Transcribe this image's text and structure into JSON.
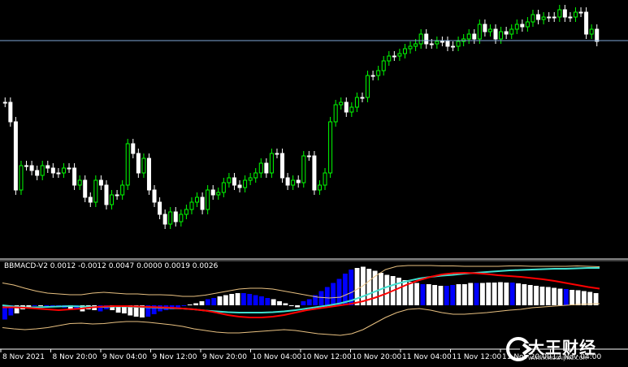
{
  "indicator": {
    "label": "BBMACD-V2 0.0012 -0.0012 0.0047 0.0000 0.0019 0.0026"
  },
  "x_axis": {
    "labels": [
      "8 Nov 2021",
      "8 Nov 20:00",
      "9 Nov 04:00",
      "9 Nov 12:00",
      "9 Nov 20:00",
      "10 Nov 04:00",
      "10 Nov 12:00",
      "10 Nov 20:00",
      "11 Nov 04:00",
      "11 Nov 12:00",
      "11 Nov 20:00",
      "12 Nov 04:00"
    ]
  },
  "watermark": {
    "brand": "大王财经",
    "site": "WWW.KINGCAIJING.COM"
  },
  "colors": {
    "background": "#000000",
    "bull_candle": "#00ff00",
    "bear_candle": "#ffffff",
    "price_line": "#7fa8d6",
    "hist_positive": "#ffffff",
    "hist_negative": "#0000ff",
    "macd_line": "#ff0000",
    "signal_line": "#40e0d0",
    "bands": "#e8c080",
    "separator": "#ffffff"
  },
  "chart_data": {
    "type": "candlestick",
    "title": "",
    "price_pane": {
      "open": [
        0.4,
        0.4,
        0.48,
        0.76,
        0.66,
        0.66,
        0.68,
        0.7,
        0.66,
        0.67,
        0.69,
        0.69,
        0.67,
        0.67,
        0.74,
        0.72,
        0.79,
        0.81,
        0.72,
        0.74,
        0.82,
        0.78,
        0.78,
        0.74,
        0.57,
        0.61,
        0.69,
        0.63,
        0.76,
        0.81,
        0.86,
        0.9,
        0.85,
        0.89,
        0.86,
        0.84,
        0.81,
        0.79,
        0.84,
        0.76,
        0.78,
        0.77,
        0.73,
        0.71,
        0.74,
        0.75,
        0.72,
        0.71,
        0.69,
        0.65,
        0.69,
        0.61,
        0.61,
        0.71,
        0.74,
        0.72,
        0.73,
        0.62,
        0.62,
        0.76,
        0.74,
        0.69,
        0.48,
        0.41,
        0.4,
        0.44,
        0.42,
        0.38,
        0.38,
        0.29,
        0.29,
        0.27,
        0.23,
        0.21,
        0.21,
        0.2,
        0.18,
        0.17,
        0.16,
        0.12,
        0.16,
        0.16,
        0.15,
        0.15,
        0.17,
        0.17,
        0.15,
        0.14,
        0.12,
        0.14,
        0.08,
        0.11,
        0.1,
        0.14,
        0.11,
        0.12,
        0.1,
        0.08,
        0.09,
        0.07,
        0.04,
        0.06,
        0.05,
        0.05,
        0.05,
        0.02,
        0.05,
        0.05,
        0.03,
        0.03,
        0.12,
        0.1
      ],
      "close": [
        0.4,
        0.48,
        0.76,
        0.66,
        0.66,
        0.68,
        0.7,
        0.66,
        0.67,
        0.69,
        0.69,
        0.67,
        0.67,
        0.74,
        0.72,
        0.79,
        0.81,
        0.72,
        0.74,
        0.82,
        0.78,
        0.78,
        0.74,
        0.57,
        0.61,
        0.69,
        0.63,
        0.76,
        0.81,
        0.86,
        0.9,
        0.85,
        0.89,
        0.86,
        0.84,
        0.81,
        0.79,
        0.84,
        0.76,
        0.78,
        0.77,
        0.73,
        0.71,
        0.74,
        0.75,
        0.72,
        0.71,
        0.69,
        0.65,
        0.69,
        0.61,
        0.61,
        0.71,
        0.74,
        0.72,
        0.73,
        0.62,
        0.62,
        0.76,
        0.74,
        0.69,
        0.48,
        0.41,
        0.4,
        0.44,
        0.42,
        0.38,
        0.38,
        0.29,
        0.29,
        0.27,
        0.23,
        0.21,
        0.21,
        0.2,
        0.18,
        0.17,
        0.16,
        0.12,
        0.16,
        0.16,
        0.15,
        0.15,
        0.17,
        0.17,
        0.15,
        0.14,
        0.12,
        0.14,
        0.08,
        0.11,
        0.1,
        0.14,
        0.11,
        0.12,
        0.1,
        0.08,
        0.09,
        0.07,
        0.04,
        0.06,
        0.05,
        0.05,
        0.05,
        0.02,
        0.05,
        0.05,
        0.03,
        0.03,
        0.12,
        0.1,
        0.15
      ],
      "high_offset": 0.02,
      "low_offset": 0.02,
      "current_price_level": 0.14
    },
    "indicator_pane": {
      "histogram": [
        0.35,
        0.25,
        0.2,
        0.1,
        0.05,
        0.02,
        0.0,
        0.02,
        0.0,
        0.03,
        0.06,
        0.1,
        0.1,
        0.15,
        0.1,
        0.12,
        0.15,
        0.1,
        0.12,
        0.18,
        0.2,
        0.25,
        0.28,
        0.3,
        0.28,
        0.22,
        0.15,
        0.12,
        0.1,
        0.05,
        0.0,
        -0.02,
        -0.05,
        -0.1,
        -0.15,
        -0.18,
        -0.22,
        -0.25,
        -0.28,
        -0.3,
        -0.3,
        -0.28,
        -0.25,
        -0.22,
        -0.18,
        -0.15,
        -0.1,
        -0.05,
        0.0,
        0.05,
        -0.1,
        -0.15,
        -0.25,
        -0.35,
        -0.45,
        -0.55,
        -0.65,
        -0.78,
        -0.88,
        -0.92,
        -0.95,
        -0.9,
        -0.85,
        -0.8,
        -0.75,
        -0.72,
        -0.68,
        -0.62,
        -0.58,
        -0.55,
        -0.52,
        -0.52,
        -0.5,
        -0.48,
        -0.48,
        -0.5,
        -0.52,
        -0.52,
        -0.55,
        -0.55,
        -0.55,
        -0.56,
        -0.56,
        -0.57,
        -0.56,
        -0.56,
        -0.54,
        -0.52,
        -0.5,
        -0.48,
        -0.46,
        -0.45,
        -0.43,
        -0.41,
        -0.4,
        -0.38,
        -0.37,
        -0.35,
        -0.33,
        -0.3
      ],
      "hist_colors": [
        "b",
        "b",
        "w",
        "w",
        "w",
        "b",
        "w",
        "b",
        "b",
        "b",
        "b",
        "w",
        "b",
        "w",
        "w",
        "w",
        "b",
        "b",
        "w",
        "w",
        "w",
        "w",
        "w",
        "w",
        "b",
        "b",
        "b",
        "b",
        "b",
        "b",
        "b",
        "w",
        "w",
        "w",
        "b",
        "b",
        "w",
        "w",
        "w",
        "w",
        "b",
        "b",
        "b",
        "b",
        "b",
        "w",
        "w",
        "w",
        "w",
        "w",
        "b",
        "b",
        "b",
        "b",
        "b",
        "b",
        "b",
        "b",
        "b",
        "w",
        "w",
        "w",
        "w",
        "w",
        "w",
        "w",
        "w",
        "w",
        "w",
        "w",
        "b",
        "w",
        "w",
        "w",
        "b",
        "b",
        "w",
        "w",
        "w",
        "b",
        "w",
        "w",
        "w",
        "w",
        "w",
        "b",
        "w",
        "w",
        "w",
        "w",
        "w",
        "w",
        "w",
        "w",
        "b",
        "w",
        "w",
        "w",
        "w",
        "w"
      ],
      "macd_line": [
        -0.05,
        -0.05,
        -0.06,
        -0.08,
        -0.1,
        -0.12,
        -0.1,
        -0.08,
        -0.05,
        -0.03,
        -0.02,
        -0.02,
        -0.03,
        -0.04,
        -0.05,
        -0.06,
        -0.08,
        -0.1,
        -0.13,
        -0.18,
        -0.24,
        -0.28,
        -0.3,
        -0.3,
        -0.28,
        -0.24,
        -0.18,
        -0.12,
        -0.08,
        -0.04,
        0.0,
        0.04,
        0.1,
        0.18,
        0.28,
        0.4,
        0.52,
        0.62,
        0.7,
        0.76,
        0.79,
        0.8,
        0.79,
        0.77,
        0.74,
        0.72,
        0.7,
        0.67,
        0.64,
        0.6,
        0.55,
        0.5,
        0.45,
        0.41
      ],
      "signal_line": [
        0.0,
        -0.03,
        -0.05,
        -0.05,
        -0.04,
        -0.03,
        -0.02,
        -0.03,
        -0.04,
        -0.04,
        -0.03,
        -0.03,
        -0.04,
        -0.05,
        -0.06,
        -0.07,
        -0.08,
        -0.1,
        -0.13,
        -0.15,
        -0.17,
        -0.18,
        -0.18,
        -0.18,
        -0.17,
        -0.15,
        -0.12,
        -0.08,
        -0.04,
        0.0,
        0.05,
        0.12,
        0.22,
        0.33,
        0.44,
        0.53,
        0.6,
        0.66,
        0.7,
        0.73,
        0.75,
        0.78,
        0.8,
        0.82,
        0.84,
        0.86,
        0.87,
        0.88,
        0.89,
        0.9,
        0.9,
        0.91,
        0.92,
        0.92
      ],
      "upper_band": [
        0.55,
        0.5,
        0.42,
        0.35,
        0.3,
        0.28,
        0.26,
        0.26,
        0.3,
        0.32,
        0.3,
        0.28,
        0.28,
        0.26,
        0.26,
        0.25,
        0.22,
        0.22,
        0.25,
        0.3,
        0.35,
        0.4,
        0.42,
        0.42,
        0.4,
        0.35,
        0.3,
        0.25,
        0.2,
        0.18,
        0.2,
        0.32,
        0.48,
        0.7,
        0.88,
        0.96,
        0.98,
        0.98,
        0.98,
        0.97,
        0.97,
        0.96,
        0.96,
        0.96,
        0.96,
        0.97,
        0.97,
        0.96,
        0.96,
        0.96,
        0.96,
        0.97,
        0.96,
        0.95
      ],
      "lower_band": [
        -0.55,
        -0.58,
        -0.6,
        -0.58,
        -0.55,
        -0.5,
        -0.45,
        -0.44,
        -0.46,
        -0.45,
        -0.42,
        -0.4,
        -0.4,
        -0.42,
        -0.45,
        -0.48,
        -0.52,
        -0.58,
        -0.62,
        -0.66,
        -0.68,
        -0.68,
        -0.66,
        -0.64,
        -0.62,
        -0.6,
        -0.62,
        -0.66,
        -0.7,
        -0.72,
        -0.74,
        -0.7,
        -0.6,
        -0.45,
        -0.3,
        -0.18,
        -0.1,
        -0.08,
        -0.12,
        -0.18,
        -0.22,
        -0.22,
        -0.2,
        -0.18,
        -0.15,
        -0.12,
        -0.1,
        -0.06,
        -0.04,
        -0.02,
        0.0,
        0.02,
        0.03,
        0.04
      ]
    }
  }
}
